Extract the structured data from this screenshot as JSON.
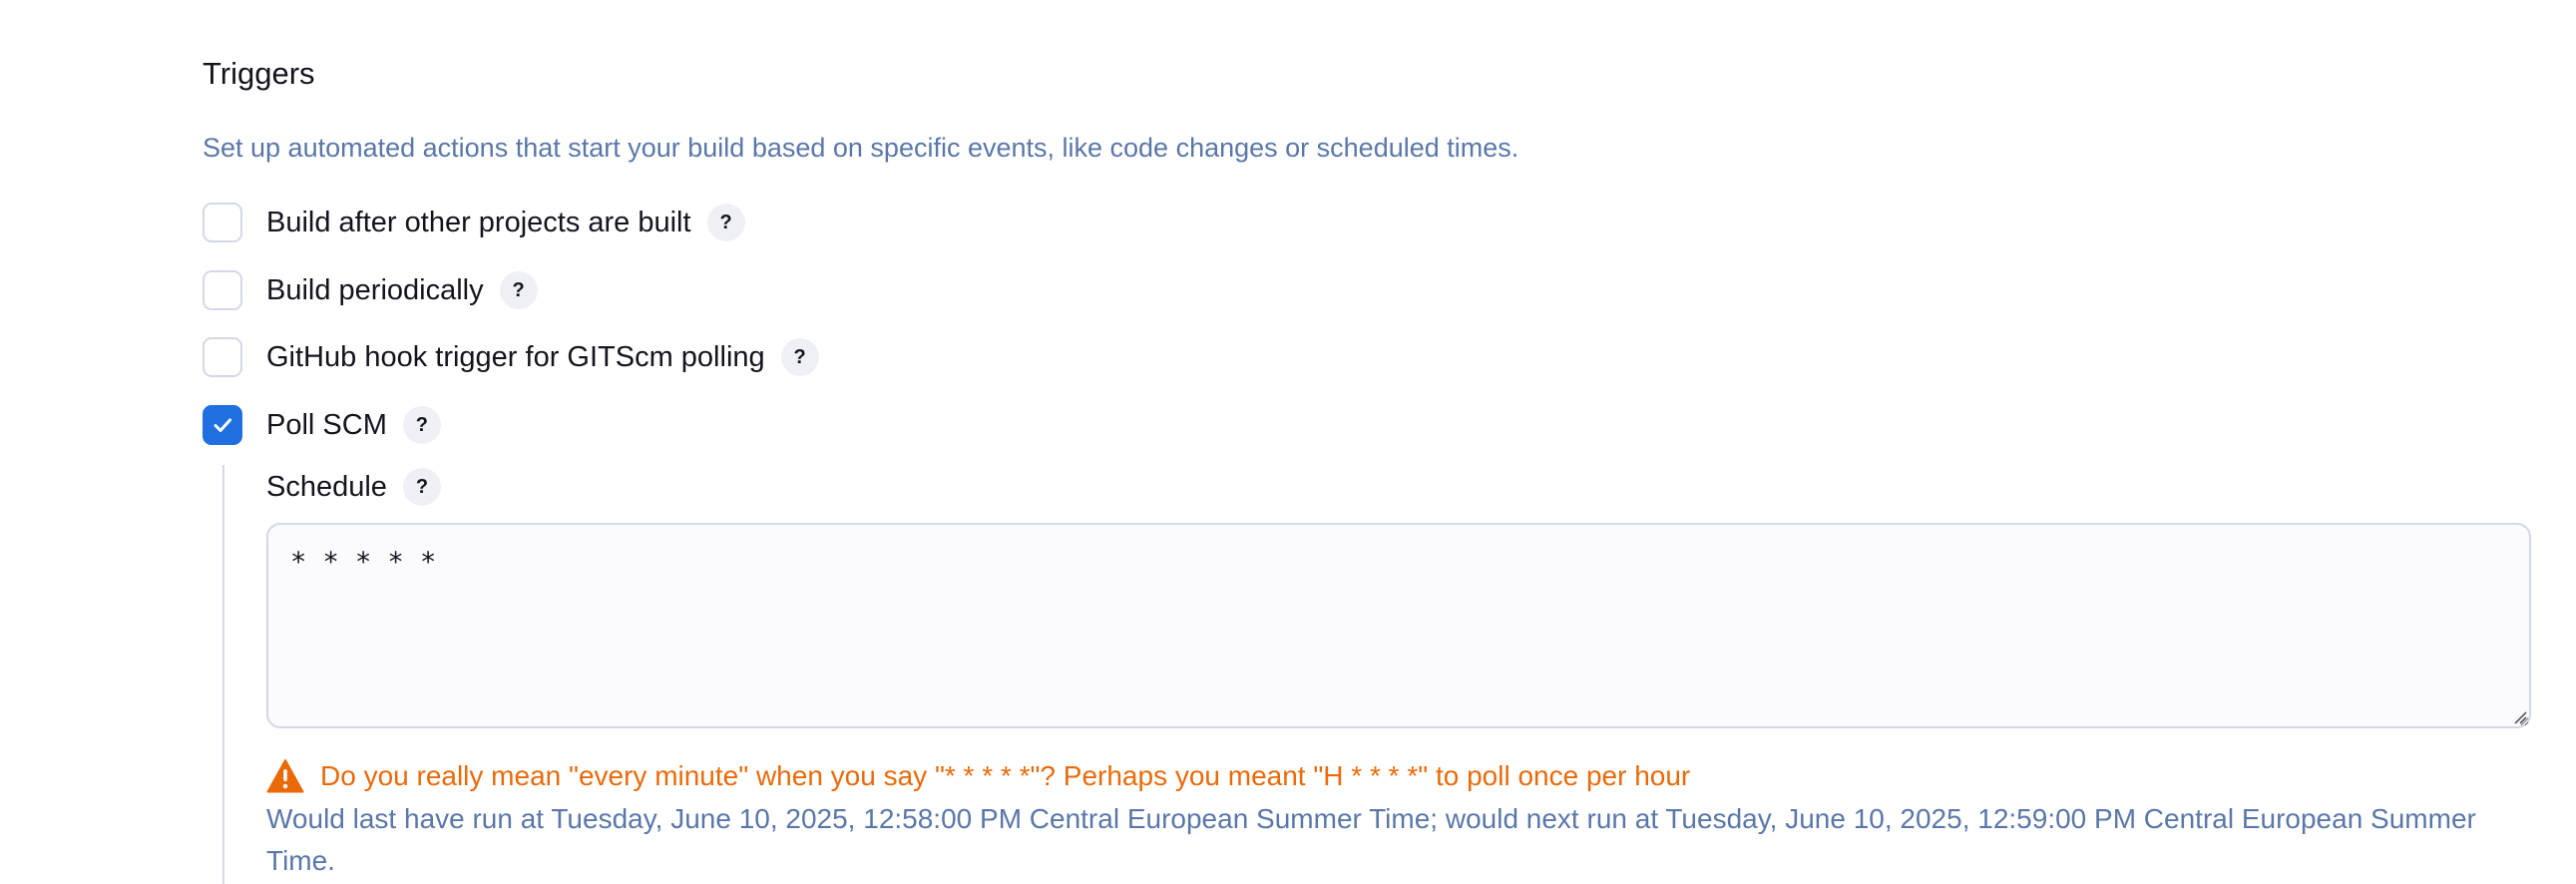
{
  "triggers": {
    "title": "Triggers",
    "description": "Set up automated actions that start your build based on specific events, like code changes or scheduled times.",
    "help_label": "?",
    "options": [
      {
        "label": "Build after other projects are built",
        "checked": false
      },
      {
        "label": "Build periodically",
        "checked": false
      },
      {
        "label": "GitHub hook trigger for GITScm polling",
        "checked": false
      },
      {
        "label": "Poll SCM",
        "checked": true
      }
    ]
  },
  "poll_scm": {
    "schedule_label": "Schedule",
    "schedule_value": "* * * * *",
    "warning_icon": "warning-triangle-icon",
    "warning_text": "Do you really mean \"every minute\" when you say \"* * * * *\"? Perhaps you meant \"H * * * *\" to poll once per hour",
    "schedule_info": "Would last have run at Tuesday, June 10, 2025, 12:58:00 PM Central European Summer Time; would next run at Tuesday, June 10, 2025, 12:59:00 PM Central European Summer Time."
  },
  "colors": {
    "accent": "#1f6fe0",
    "warning": "#ea6a0a",
    "muted_text": "#5a77a8",
    "border": "#d4d8e6"
  }
}
